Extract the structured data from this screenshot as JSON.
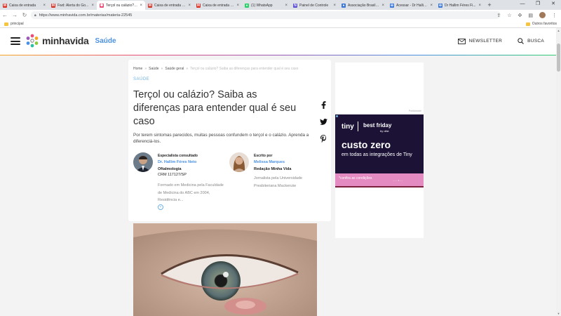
{
  "browser": {
    "tabs": [
      {
        "title": "Caixa de entrada",
        "icon": "gmail-icon",
        "color": "#d93025",
        "glyph": "M"
      },
      {
        "title": "Fwd: Alerta do Go...",
        "icon": "gmail-icon",
        "color": "#d93025",
        "glyph": "M"
      },
      {
        "title": "Terçol ou calázio? ...",
        "icon": "minhavida-icon",
        "color": "#e94e77",
        "glyph": "✺",
        "active": true
      },
      {
        "title": "Caixa de entrada - ...",
        "icon": "gmail-icon",
        "color": "#d93025",
        "glyph": "M"
      },
      {
        "title": "Caixa de entrada - ...",
        "icon": "gmail-icon",
        "color": "#d93025",
        "glyph": "M"
      },
      {
        "title": "(1) WhatsApp",
        "icon": "whatsapp-icon",
        "color": "#25d366",
        "glyph": "●"
      },
      {
        "title": "Painel de Controle",
        "icon": "panel-icon",
        "color": "#5b4fcf",
        "glyph": "N"
      },
      {
        "title": "Associação Brasile...",
        "icon": "globe-icon",
        "color": "#3b78d8",
        "glyph": "●"
      },
      {
        "title": "Acessar - Dr Hallim...",
        "icon": "login-icon",
        "color": "#3b78d8",
        "glyph": "⊖"
      },
      {
        "title": "Dr Hallim Féres Fi...",
        "icon": "login-icon",
        "color": "#3b78d8",
        "glyph": "⊖"
      }
    ],
    "url": "https://www.minhavida.com.br/materias/materia-22545",
    "bookmarks": {
      "left": "principal",
      "right": "Outros favoritos"
    }
  },
  "site": {
    "logo": "minhavida",
    "section": "Saúde",
    "newsletter": "NEWSLETTER",
    "search": "BUSCA"
  },
  "article": {
    "breadcrumb": [
      "Home",
      "Saúde",
      "Saúde geral",
      "Terçol ou calázio? Saiba as diferenças para entender qual é seu caso"
    ],
    "category": "SAÚDE",
    "title": "Terçol ou calázio? Saiba as diferenças para entender qual é seu caso",
    "lead": "Por terem sintomas parecidos, muitas pessoas confundem o terçol e o calázio. Aprenda a diferenciá-los.",
    "consultant": {
      "role": "Especialista consultado",
      "name": "Dr. Hallim Féres Neto",
      "specialty": "Oftalmologia",
      "crm": "CRM 117127/SP",
      "bio": "Formado em Medicina pela Faculdade de Medicina do ABC em 2004, Residência e..."
    },
    "writer": {
      "role": "Escrito por",
      "name": "Melissa Marques",
      "outlet": "Redação Minha Vida",
      "bio": "Jornalista pela Universidade Presbiteriana Mackenzie"
    }
  },
  "ad": {
    "label": "Publicidade",
    "brand": "tiny",
    "promo": "best friday",
    "promo_by": "by olist",
    "headline": "custo zero",
    "desc": "em todas as integrações de Tiny",
    "cta": "*confira as condições"
  }
}
